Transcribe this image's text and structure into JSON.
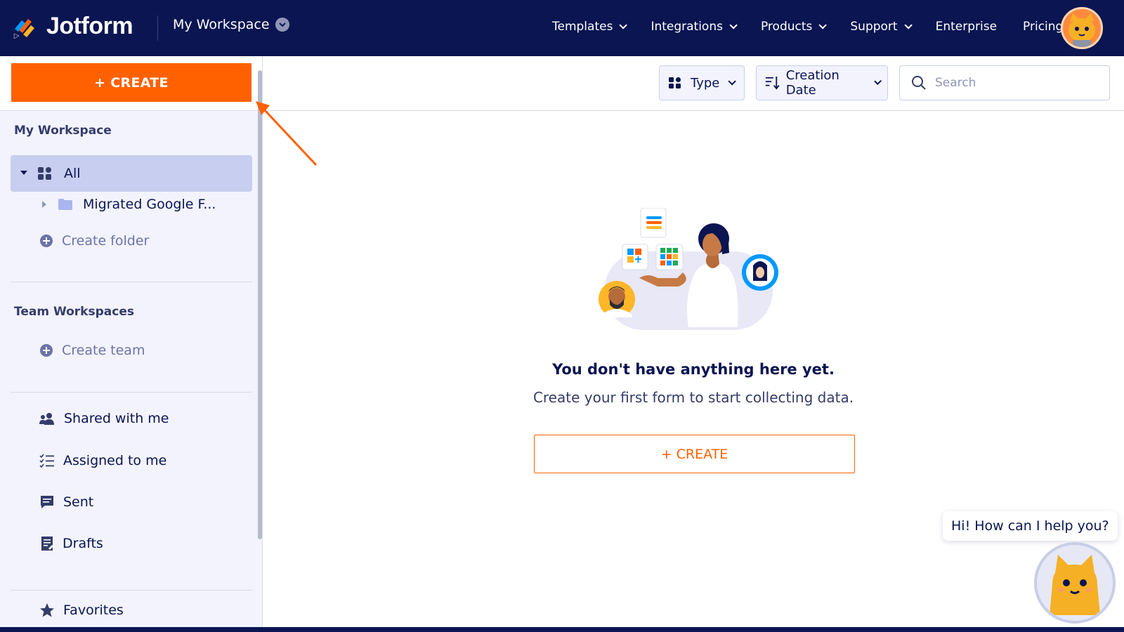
{
  "brand": {
    "name": "Jotform"
  },
  "header": {
    "workspace_label": "My Workspace",
    "nav": [
      {
        "label": "Templates",
        "has_dropdown": true
      },
      {
        "label": "Integrations",
        "has_dropdown": true
      },
      {
        "label": "Products",
        "has_dropdown": true
      },
      {
        "label": "Support",
        "has_dropdown": true
      },
      {
        "label": "Enterprise",
        "has_dropdown": false
      },
      {
        "label": "Pricing",
        "has_dropdown": false
      }
    ]
  },
  "sidebar": {
    "create_label": "+ CREATE",
    "my_workspace_heading": "My Workspace",
    "all_label": "All",
    "folder_label": "Migrated Google F...",
    "create_folder_label": "Create folder",
    "team_heading": "Team Workspaces",
    "create_team_label": "Create team",
    "shared_label": "Shared with me",
    "assigned_label": "Assigned to me",
    "sent_label": "Sent",
    "drafts_label": "Drafts",
    "favorites_label": "Favorites"
  },
  "toolbar": {
    "type_label": "Type",
    "sort_label": "Creation Date",
    "search_placeholder": "Search"
  },
  "empty_state": {
    "title": "You don't have anything here yet.",
    "subtitle": "Create your first form to start collecting data.",
    "create_label": "+ CREATE"
  },
  "chat": {
    "message": "Hi! How can I help you?"
  },
  "colors": {
    "navy": "#0a1551",
    "orange": "#ff6100",
    "sidebar_bg": "#f3f3fe",
    "selected_bg": "#c8ceef"
  },
  "icons": [
    "jotform-logo-icon",
    "chevron-down-icon",
    "grid-icon",
    "caret-down-icon",
    "caret-right-icon",
    "folder-icon",
    "plus-circle-icon",
    "sort-icon",
    "search-icon",
    "users-icon",
    "checklist-icon",
    "message-icon",
    "document-icon",
    "star-icon",
    "arrow-icon"
  ]
}
